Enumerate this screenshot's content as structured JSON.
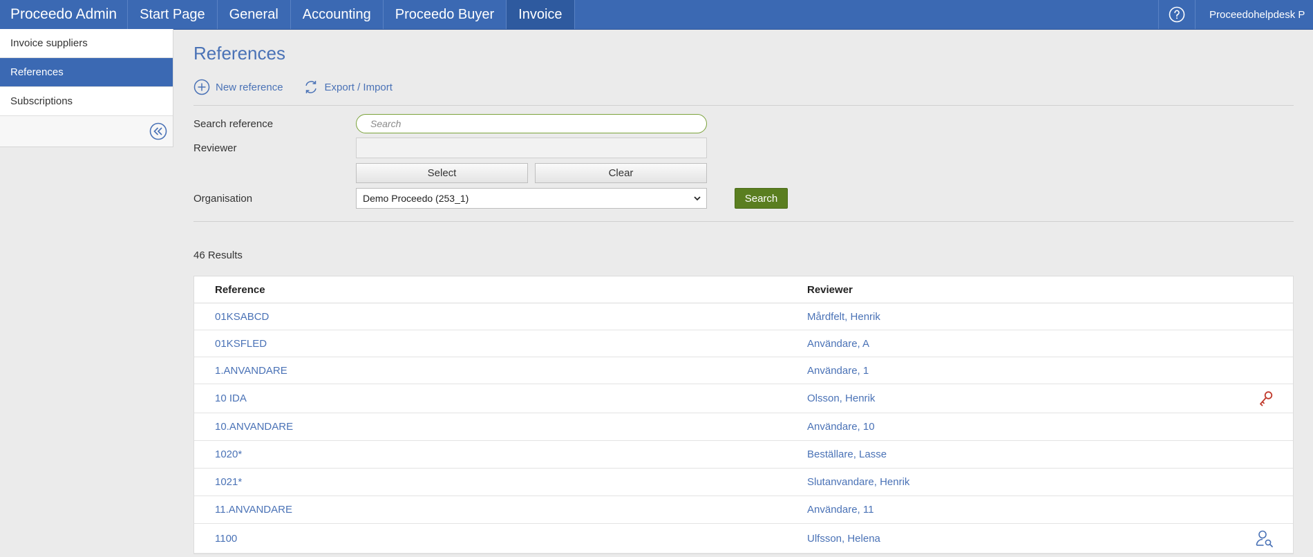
{
  "topnav": {
    "brand": "Proceedo Admin",
    "items": [
      {
        "label": "Start Page",
        "active": false
      },
      {
        "label": "General",
        "active": false
      },
      {
        "label": "Accounting",
        "active": false
      },
      {
        "label": "Proceedo Buyer",
        "active": false
      },
      {
        "label": "Invoice",
        "active": true
      }
    ],
    "help_icon": "question-circle-icon",
    "user_name": "Proceedohelpdesk P"
  },
  "sidebar": {
    "items": [
      {
        "label": "Invoice suppliers",
        "active": false
      },
      {
        "label": "References",
        "active": true
      },
      {
        "label": "Subscriptions",
        "active": false
      }
    ],
    "collapse_icon": "double-chevron-left-icon"
  },
  "page": {
    "title": "References",
    "actions": {
      "new_reference": "New reference",
      "export_import": "Export / Import"
    }
  },
  "form": {
    "search_label": "Search reference",
    "search_placeholder": "Search",
    "reviewer_label": "Reviewer",
    "select_button": "Select",
    "clear_button": "Clear",
    "organisation_label": "Organisation",
    "organisation_value": "Demo Proceedo (253_1)",
    "search_button": "Search"
  },
  "results": {
    "count_text": "46 Results",
    "columns": {
      "reference": "Reference",
      "reviewer": "Reviewer"
    },
    "rows": [
      {
        "reference": "01KSABCD",
        "reviewer": "Mårdfelt, Henrik",
        "icon": null
      },
      {
        "reference": "01KSFLED",
        "reviewer": "Användare, A",
        "icon": null
      },
      {
        "reference": "1.ANVANDARE",
        "reviewer": "Användare, 1",
        "icon": null
      },
      {
        "reference": "10 IDA",
        "reviewer": "Olsson, Henrik",
        "icon": "key-icon"
      },
      {
        "reference": "10.ANVANDARE",
        "reviewer": "Användare, 10",
        "icon": null
      },
      {
        "reference": "1020*",
        "reviewer": "Beställare, Lasse",
        "icon": null
      },
      {
        "reference": "1021*",
        "reviewer": "Slutanvandare, Henrik",
        "icon": null
      },
      {
        "reference": "11.ANVANDARE",
        "reviewer": "Användare, 11",
        "icon": null
      },
      {
        "reference": "1100",
        "reviewer": "Ulfsson, Helena",
        "icon": "user-search-icon"
      }
    ]
  },
  "colors": {
    "nav_blue": "#3b69b3",
    "link_blue": "#4a72b6",
    "search_green": "#5a7e20",
    "key_red": "#c0392b"
  }
}
